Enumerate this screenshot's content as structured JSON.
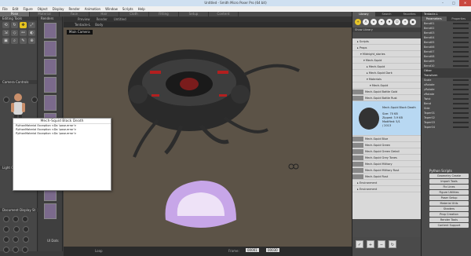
{
  "window": {
    "title": "Untitled - Smith Micro Poser Pro  (64 bit)"
  },
  "menu": [
    "File",
    "Edit",
    "Figure",
    "Object",
    "Display",
    "Render",
    "Animation",
    "Window",
    "Scripts",
    "Help"
  ],
  "tabs": [
    "Pose",
    "Material",
    "Face",
    "Hair",
    "Cloth",
    "Fitting",
    "Setup",
    "Content"
  ],
  "left": {
    "editing_tools": "Editing Tools",
    "renders": "Renders",
    "camera_controls": "Camera Controls",
    "light_controls": "Light Controls",
    "document_display": "Document Display St"
  },
  "viewport": {
    "preview": "Preview",
    "render": "Render",
    "untitled": "Untitled",
    "figure_select": "Tentacle-L",
    "part_select": "Body",
    "camera_label": "Main Camera",
    "frame_label": "Frame:",
    "frame_value": "00001",
    "frame_total": "00030",
    "loop": "Loop",
    "skip": "Skip Frames",
    "ui_dots": "UI Dots"
  },
  "dialog": {
    "title": "Mech-Squid Black Death",
    "lines": [
      "PythonMaterial Exception <Do 'pose.error'>",
      "PythonMaterial Exception <Do 'pose.error'>",
      "PythonMaterial Exception <Do 'pose.error'>"
    ]
  },
  "library": {
    "tabs": [
      "Library",
      "Search",
      "Favorites"
    ],
    "icons": [
      "+",
      "A",
      "★",
      "✦",
      "♦",
      "☺",
      "☀",
      "▣"
    ],
    "show_label": "Show Library",
    "tree": [
      "Scripts",
      "Props",
      "Midnight_stories",
      "Mech-Squid",
      "Mech-Squid",
      "Mech-Squid Dark",
      "Materials",
      "Mech-Squid",
      "Mech-Squid Battle Gold",
      "Mech-Squid Battle Rust",
      "Mech-Squid Black Death",
      "Mech-Squid Blue",
      "Mech-Squid Green",
      "Mech-Squid Green Detail",
      "Mech-Squid Grey Tones",
      "Mech-Squid Military",
      "Mech-Squid Military Rust",
      "Mech-Squid Rust",
      "Environment",
      "Environment"
    ],
    "selected_info": [
      "Size: 70 KB",
      "Zipped: 3.9 KB",
      "Modified: 5/1",
      "/ 2013"
    ]
  },
  "params": {
    "header": "Tentacle-L",
    "tabs": [
      "Parameters",
      "Properties"
    ],
    "rows": [
      "Bend01",
      "Bend02",
      "Bend03",
      "Bend04",
      "Bend05",
      "Bend06",
      "Bend07",
      "Bend08",
      "Bend09",
      "Bend10",
      "Body",
      "Scale",
      "Translate",
      "xRotate",
      "yRotate",
      "zRotate",
      "Twist",
      "Bend",
      "Side",
      "Taper01",
      "Taper02",
      "Taper03",
      "Taper04",
      "Taper05",
      "Taper06",
      "Taper07",
      "Taper08",
      "Taper09"
    ],
    "sections": [
      "Other",
      "Transform"
    ],
    "values": [
      "0.0",
      "0",
      "100%",
      "0.00",
      "0.00",
      "0.00",
      "0.00"
    ]
  },
  "python": {
    "title": "Python Scripts",
    "buttons": [
      "Geometry Create",
      "Import Tools",
      "Fix Lines",
      "Figure Utilities",
      "Poser Setup",
      "Material Utils",
      "Shaders",
      "Prop Creation",
      "Render Tools",
      "Content Support"
    ]
  },
  "colors": {
    "accent": "#e6c31f",
    "viewport": "#5c5347",
    "selection": "#9ec7e8"
  }
}
